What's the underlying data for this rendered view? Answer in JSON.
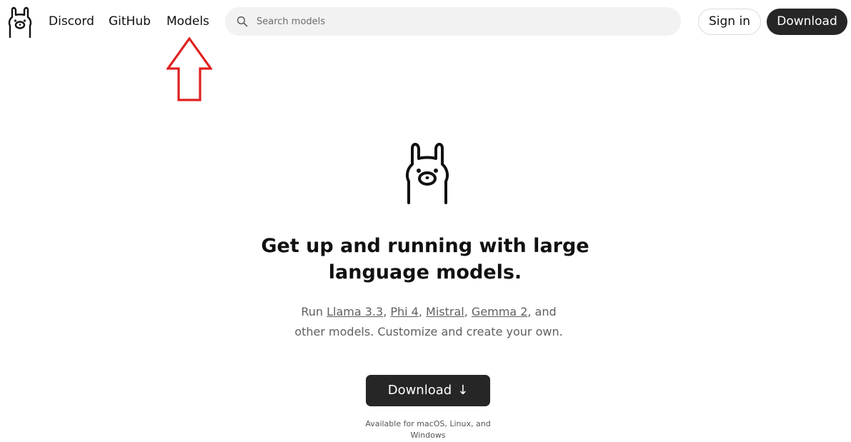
{
  "header": {
    "logo_icon": "ollama-llama-icon",
    "nav": {
      "discord": "Discord",
      "github": "GitHub",
      "models": "Models"
    },
    "search": {
      "icon": "search-icon",
      "placeholder": "Search models"
    },
    "sign_in_label": "Sign in",
    "download_label": "Download"
  },
  "annotation": {
    "icon": "up-arrow-icon",
    "color": "#e02020"
  },
  "hero": {
    "logo_icon": "ollama-llama-icon",
    "headline_line1": "Get up and running with large",
    "headline_line2": "language models.",
    "sub": {
      "prefix": "Run ",
      "models": [
        "Llama 3.3",
        "Phi 4",
        "Mistral",
        "Gemma 2"
      ],
      "sep": ", ",
      "suffix_line1": ", and",
      "line2": "other models. Customize and create your own."
    },
    "download_label": "Download",
    "download_arrow": "↓",
    "availability_line1": "Available for macOS, Linux, and",
    "availability_line2": "Windows"
  },
  "colors": {
    "primary_button": "#262626",
    "search_bg": "#f2f2f2",
    "muted_text": "#5f5f5f"
  }
}
